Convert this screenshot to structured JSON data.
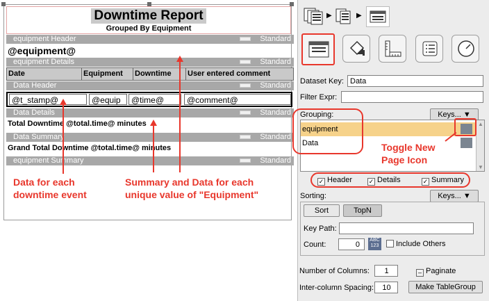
{
  "report": {
    "title": "Downtime Report",
    "subtitle": "Grouped By Equipment",
    "standard_label": "Standard",
    "bands": {
      "equipment_header": "equipment Header",
      "equipment_details": "equipment Details",
      "data_header": "Data Header",
      "data_details": "Data Details",
      "data_summary": "Data Summary",
      "equipment_summary": "equipment Summary"
    },
    "group_field": "@equipment@",
    "columns": [
      "Date",
      "Equipment",
      "Downtime",
      "User entered comment"
    ],
    "detail_cells": [
      "@t_stamp@",
      "@equip",
      "@time@",
      "@comment@"
    ],
    "total_line": "Total Downtime @total.time@ minutes",
    "grand_total_line": "Grand Total Downtime @total.time@ minutes"
  },
  "annotations": {
    "data_event_line1": "Data for each",
    "data_event_line2": "downtime event",
    "summary_line1": "Summary and Data for each",
    "summary_line2": "unique value of \"Equipment\"",
    "toggle_line1": "Toggle New",
    "toggle_line2": "Page Icon"
  },
  "panel": {
    "dataset_key_label": "Dataset Key:",
    "dataset_key_value": "Data",
    "filter_expr_label": "Filter Expr:",
    "filter_expr_value": "",
    "grouping_label": "Grouping:",
    "keys_button": "Keys...",
    "grouping_items": [
      "equipment",
      "Data"
    ],
    "checkboxes": [
      "Header",
      "Details",
      "Summary"
    ],
    "sorting_label": "Sorting:",
    "sort_button": "Sort",
    "topn_button": "TopN",
    "key_path_label": "Key Path:",
    "key_path_value": "",
    "count_label": "Count:",
    "count_value": "0",
    "include_others_label": "Include Others",
    "abc_badge_top": "ABC",
    "abc_badge_bottom": "123",
    "num_columns_label": "Number of Columns:",
    "num_columns_value": "1",
    "paginate_label": "Paginate",
    "spacing_label": "Inter-column Spacing:",
    "spacing_value": "10",
    "make_table_group": "Make TableGroup"
  },
  "colors": {
    "annotation": "#e8372c",
    "band": "#a8a8a8",
    "selected_row": "#f6d28a",
    "toggle_icon": "#7b8591"
  }
}
